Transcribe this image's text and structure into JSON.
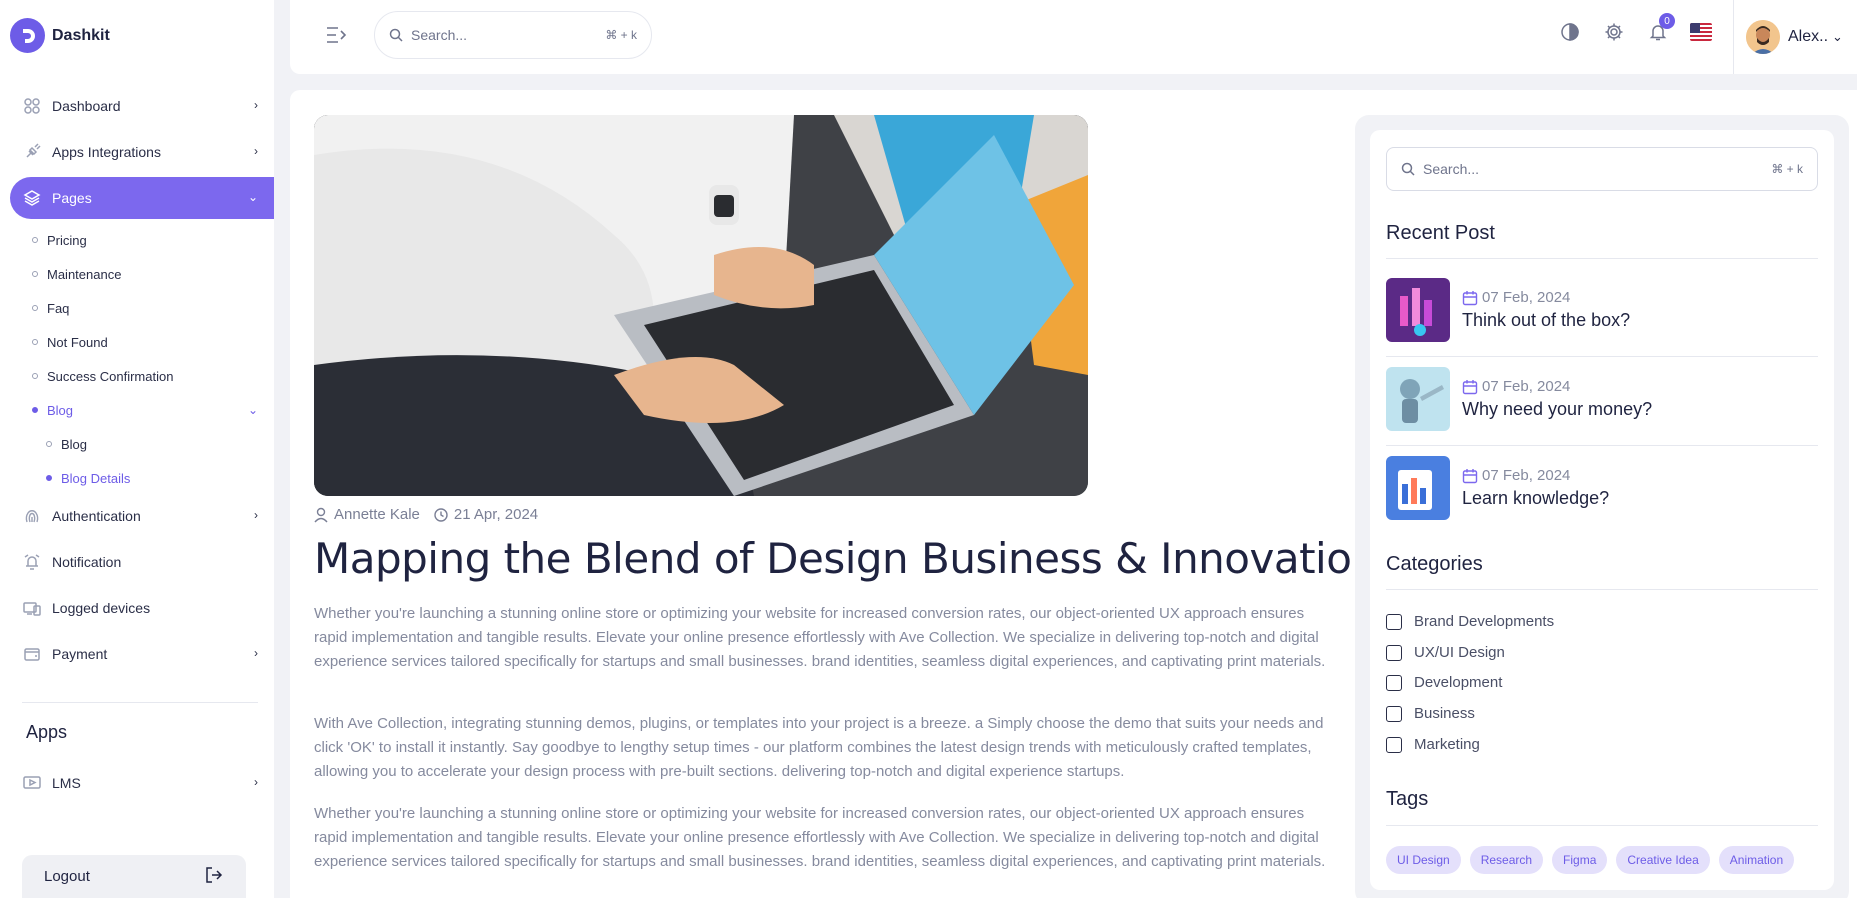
{
  "brand": {
    "name": "Dashkit"
  },
  "sidebar": {
    "items": [
      {
        "label": "Dashboard"
      },
      {
        "label": "Apps Integrations"
      },
      {
        "label": "Pages"
      },
      {
        "label": "Authentication"
      },
      {
        "label": "Notification"
      },
      {
        "label": "Logged devices"
      },
      {
        "label": "Payment"
      }
    ],
    "pages_sub": [
      {
        "label": "Pricing"
      },
      {
        "label": "Maintenance"
      },
      {
        "label": "Faq"
      },
      {
        "label": "Not Found"
      },
      {
        "label": "Success Confirmation"
      },
      {
        "label": "Blog"
      }
    ],
    "blog_sub": [
      {
        "label": "Blog"
      },
      {
        "label": "Blog Details"
      }
    ],
    "apps_title": "Apps",
    "apps": [
      {
        "label": "LMS"
      }
    ],
    "logout_label": "Logout"
  },
  "header": {
    "search_placeholder": "Search...",
    "search_shortcut": "⌘ + k",
    "notification_count": "0",
    "user_name": "Alex.."
  },
  "post": {
    "author": "Annette Kale",
    "date": "21 Apr, 2024",
    "title": "Mapping the Blend of Design Business & Innovation",
    "paragraphs": [
      "Whether you're launching a stunning online store or optimizing your website for increased conversion rates, our object-oriented UX approach ensures rapid implementation and tangible results. Elevate your online presence effortlessly with Ave Collection. We specialize in delivering top-notch and digital experience services tailored specifically for startups and small businesses. brand identities, seamless digital experiences, and captivating print materials.",
      "With Ave Collection, integrating stunning demos, plugins, or templates into your project is a breeze. a Simply choose the demo that suits your needs and click 'OK' to install it instantly. Say goodbye to lengthy setup times - our platform combines the latest design trends with meticulously crafted templates, allowing you to accelerate your design process with pre-built sections. delivering top-notch and digital experience startups.",
      "Whether you're launching a stunning online store or optimizing your website for increased conversion rates, our object-oriented UX approach ensures rapid implementation and tangible results. Elevate your online presence effortlessly with Ave Collection. We specialize in delivering top-notch and digital experience services tailored specifically for startups and small businesses. brand identities, seamless digital experiences, and captivating print materials."
    ]
  },
  "right": {
    "search_placeholder": "Search...",
    "search_shortcut": "⌘ + k",
    "recent_title": "Recent Post",
    "recent": [
      {
        "date": "07 Feb, 2024",
        "title": "Think out of the box?"
      },
      {
        "date": "07 Feb, 2024",
        "title": "Why need your money?"
      },
      {
        "date": "07 Feb, 2024",
        "title": "Learn knowledge?"
      }
    ],
    "categories_title": "Categories",
    "categories": [
      "Brand Developments",
      "UX/UI Design",
      "Development",
      "Business",
      "Marketing"
    ],
    "tags_title": "Tags",
    "tags": [
      "UI Design",
      "Research",
      "Figma",
      "Creative Idea",
      "Animation"
    ]
  },
  "colors": {
    "accent": "#7c68ee",
    "text": "#1f2340",
    "muted": "#858a9e"
  }
}
